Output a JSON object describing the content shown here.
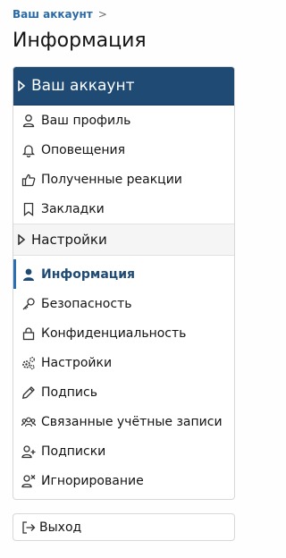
{
  "breadcrumb": {
    "label": "Ваш аккаунт"
  },
  "page_title": "Информация",
  "account_block": {
    "header": "Ваш аккаунт",
    "items": [
      {
        "label": "Ваш профиль",
        "icon": "user-icon"
      },
      {
        "label": "Оповещения",
        "icon": "bell-icon"
      },
      {
        "label": "Полученные реакции",
        "icon": "thumbs-up-icon"
      },
      {
        "label": "Закладки",
        "icon": "bookmark-icon"
      }
    ]
  },
  "settings_section": {
    "header": "Настройки",
    "items": [
      {
        "label": "Информация",
        "icon": "user-icon",
        "active": true
      },
      {
        "label": "Безопасность",
        "icon": "key-icon"
      },
      {
        "label": "Конфиденциальность",
        "icon": "lock-icon"
      },
      {
        "label": "Настройки",
        "icon": "cogs-icon"
      },
      {
        "label": "Подпись",
        "icon": "pen-icon"
      },
      {
        "label": "Связанные учётные записи",
        "icon": "users-icon"
      },
      {
        "label": "Подписки",
        "icon": "user-plus-icon"
      },
      {
        "label": "Игнорирование",
        "icon": "user-times-icon"
      }
    ]
  },
  "logout": {
    "label": "Выход",
    "icon": "sign-out-icon"
  },
  "colors": {
    "header_bg": "#1e4a74",
    "link": "#2b6aa6",
    "active_bar": "#2a6fb2"
  }
}
